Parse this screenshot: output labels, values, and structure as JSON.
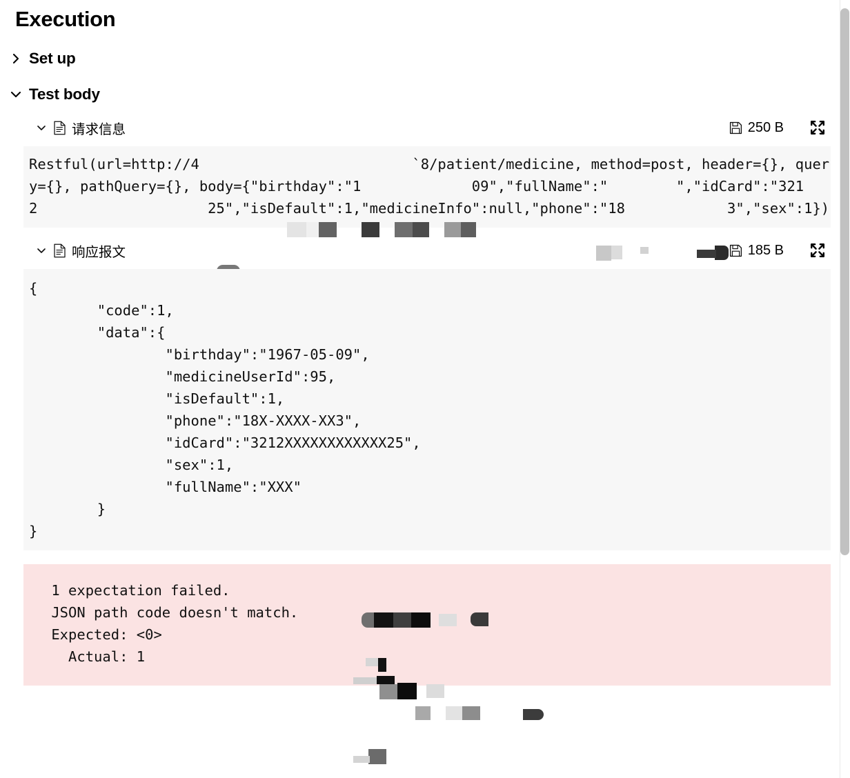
{
  "header": {
    "title": "Execution"
  },
  "sections": [
    {
      "label": "Set up",
      "state": "collapsed",
      "chevron": "chevron-right-icon"
    },
    {
      "label": "Test body",
      "state": "expanded",
      "chevron": "chevron-down-icon"
    }
  ],
  "blocks": [
    {
      "id": "request",
      "title": "请求信息",
      "chevron": "chevron-down-icon",
      "doc_icon": "document-icon",
      "save_icon": "save-icon",
      "size": "250 B",
      "expand_icon": "expand-icon",
      "code": "Restful(url=http://4                         `8/patient/medicine, method=post, header={}, query={}, pathQuery={}, body={\"birthday\":\"1             09\",\"fullName\":\"        \",\"idCard\":\"3212                    25\",\"isDefault\":1,\"medicineInfo\":null,\"phone\":\"18            3\",\"sex\":1})"
    },
    {
      "id": "response",
      "title": "响应报文",
      "chevron": "chevron-down-icon",
      "doc_icon": "document-icon",
      "save_icon": "save-icon",
      "size": "185 B",
      "expand_icon": "expand-icon",
      "code": "{\n        \"code\":1,\n        \"data\":{\n                \"birthday\":\"1967-05-09\",\n                \"medicineUserId\":95,\n                \"isDefault\":1,\n                \"phone\":\"18X-XXXX-XX3\",\n                \"idCard\":\"3212XXXXXXXXXXXX25\",\n                \"sex\":1,\n                \"fullName\":\"XXX\"\n        }\n}"
    }
  ],
  "error": {
    "text": " 1 expectation failed.\n JSON path code doesn't match.\n Expected: <0>\n   Actual: 1",
    "background_color": "#fbe3e3"
  },
  "colors": {
    "code_background": "#f7f7f7",
    "error_background": "#fbe3e3",
    "text": "#101010",
    "scrollbar_thumb": "#c1c1c1"
  },
  "scrollbar": {
    "name": "vertical-scrollbar"
  }
}
